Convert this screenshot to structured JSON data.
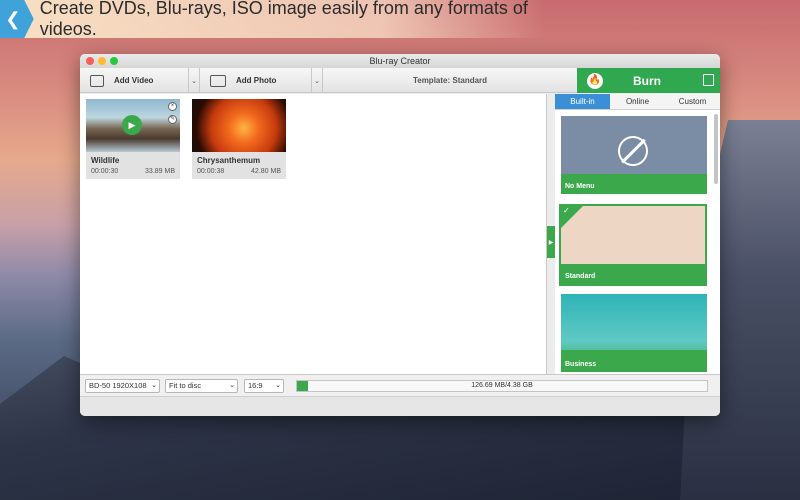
{
  "banner": {
    "text": "Create DVDs, Blu-rays, ISO image easily from any formats of videos."
  },
  "window": {
    "title": "Blu-ray Creator"
  },
  "toolbar": {
    "add_video": "Add Video",
    "add_photo": "Add Photo",
    "template": "Template: Standard",
    "burn": "Burn"
  },
  "clips": [
    {
      "name": "Wildlife",
      "duration": "00:00:30",
      "size": "33.89 MB"
    },
    {
      "name": "Chrysanthemum",
      "duration": "00:00:38",
      "size": "42.80 MB"
    }
  ],
  "side": {
    "tabs": [
      "Built-in",
      "Online",
      "Custom"
    ],
    "templates": [
      "No Menu",
      "Standard",
      "Business"
    ]
  },
  "bottom": {
    "disc": "BD-50 1920X108",
    "fit": "Fit to disc",
    "aspect": "16:9",
    "usage": "126.69 MB/4.38 GB",
    "usage_fraction": 0.028
  },
  "colors": {
    "accent_green": "#3aa84b",
    "tab_blue": "#3b8fd6"
  }
}
